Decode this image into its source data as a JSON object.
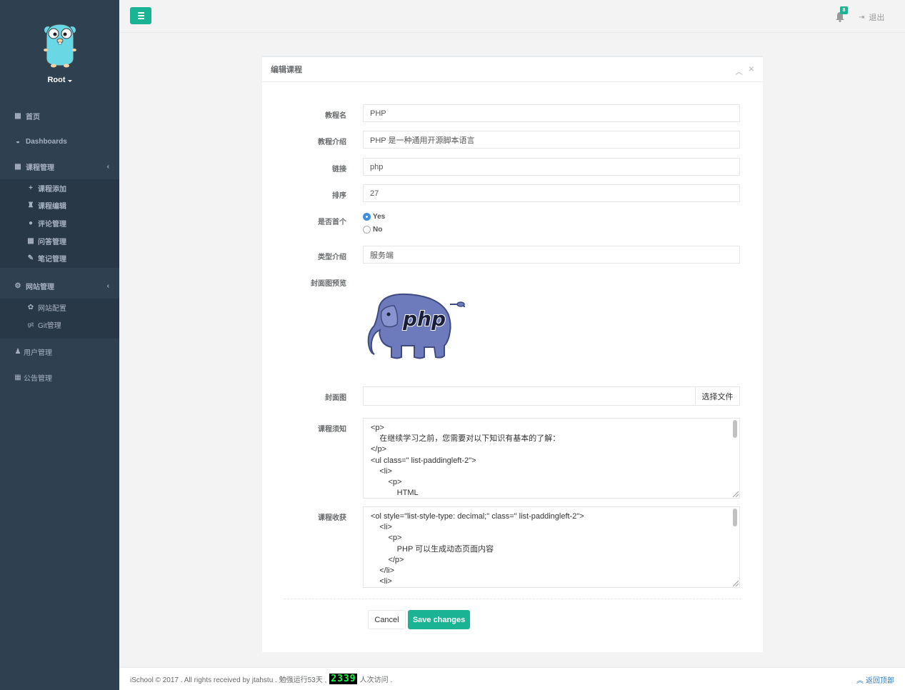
{
  "sidebar": {
    "profile_name": "Root",
    "menu": {
      "home": "首页",
      "dashboards": "Dashboards",
      "course_mgmt": "课程管理",
      "course_add": "课程添加",
      "course_edit": "课程编辑",
      "comment_mgmt": "评论管理",
      "qa_mgmt": "问答管理",
      "note_mgmt": "笔记管理",
      "site_mgmt": "网站管理",
      "site_config": "网站配置",
      "git_mgmt": "Git管理",
      "user_mgmt": "用户管理",
      "notice_mgmt": "公告管理"
    }
  },
  "topbar": {
    "notification_count": "8",
    "logout_label": "退出"
  },
  "form": {
    "title": "编辑课程",
    "fields": {
      "name_label": "教程名",
      "name_value": "PHP",
      "intro_label": "教程介绍",
      "intro_value": "PHP 是一种通用开源脚本语言",
      "link_label": "链接",
      "link_value": "php",
      "order_label": "排序",
      "order_value": "27",
      "first_label": "是否首个",
      "first_yes": "Yes",
      "first_no": "No",
      "type_label": "类型介绍",
      "type_value": "服务端",
      "cover_preview_label": "封面图预览",
      "cover_label": "封面图",
      "choose_file": "选择文件",
      "notice_label": "课程须知",
      "notice_lines": [
        "<p>",
        "    在继续学习之前，您需要对以下知识有基本的了解：",
        "</p>",
        "<ul class=\" list-paddingleft-2\">",
        "    <li>",
        "        <p>",
        "            HTML"
      ],
      "gain_label": "课程收获",
      "gain_lines": [
        "<ol style=\"list-style-type: decimal;\" class=\" list-paddingleft-2\">",
        "    <li>",
        "        <p>",
        "            PHP 可以生成动态页面内容",
        "        </p>",
        "    </li>",
        "    <li>"
      ]
    },
    "cover_logo_text": "php",
    "cancel_label": "Cancel",
    "save_label": "Save changes"
  },
  "footer": {
    "text_before": "iSchool © 2017 . All rights received by jtahstu . 勉强运行53天 ,",
    "counter_digits": [
      "2",
      "3",
      "3",
      "9"
    ],
    "text_after": "人次访问 .",
    "back_top": "返回顶部"
  },
  "colors": {
    "sidebar_bg": "#2f4050",
    "accent": "#1ab394"
  }
}
